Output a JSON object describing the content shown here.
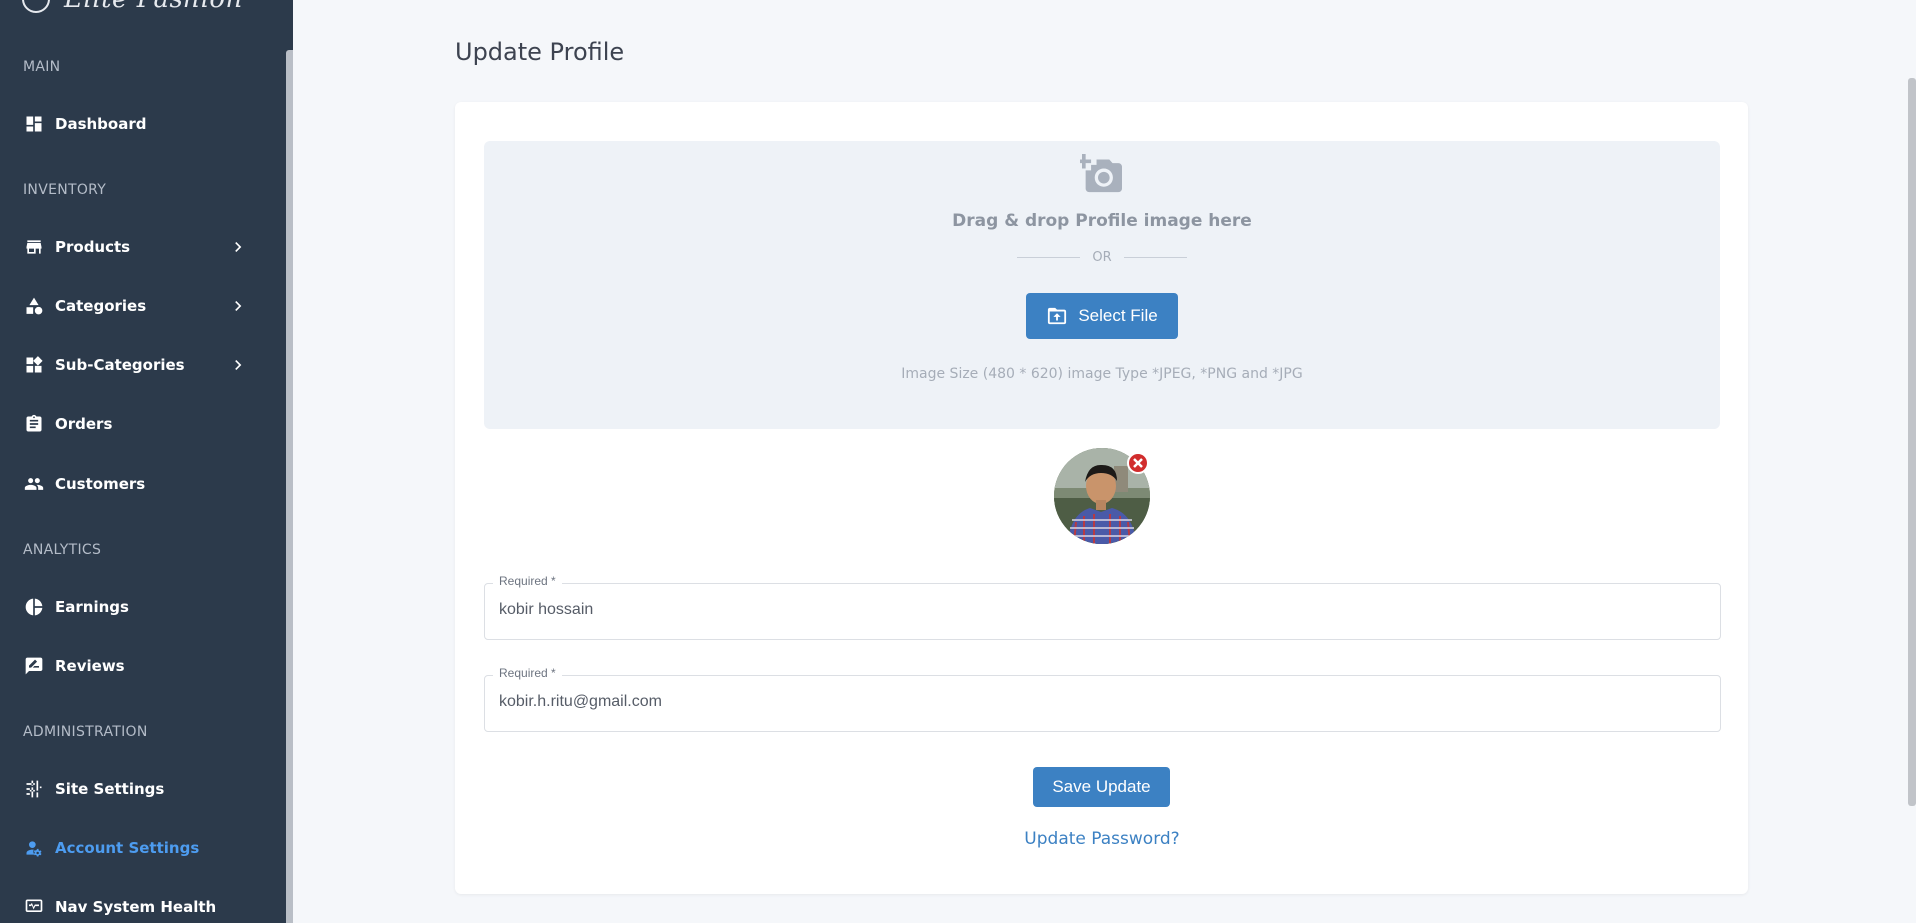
{
  "brand": {
    "name": "Elite Fashion"
  },
  "sidebar": {
    "sections": {
      "main": "MAIN",
      "inventory": "INVENTORY",
      "analytics": "ANALYTICS",
      "administration": "ADMINISTRATION"
    },
    "items": {
      "dashboard": {
        "label": "Dashboard",
        "icon": "dashboard-icon"
      },
      "products": {
        "label": "Products",
        "icon": "store-icon",
        "expandable": true
      },
      "categories": {
        "label": "Categories",
        "icon": "shapes-icon",
        "expandable": true
      },
      "subcategories": {
        "label": "Sub-Categories",
        "icon": "widgets-icon",
        "expandable": true
      },
      "orders": {
        "label": "Orders",
        "icon": "clipboard-icon"
      },
      "customers": {
        "label": "Customers",
        "icon": "people-icon"
      },
      "earnings": {
        "label": "Earnings",
        "icon": "pie-chart-icon"
      },
      "reviews": {
        "label": "Reviews",
        "icon": "rate-review-icon"
      },
      "site_settings": {
        "label": "Site Settings",
        "icon": "sliders-icon"
      },
      "account_settings": {
        "label": "Account Settings",
        "icon": "manage-accounts-icon",
        "active": true
      },
      "nav_system_health": {
        "label": "Nav System Health",
        "icon": "monitor-heart-icon"
      }
    },
    "active_color": "#4d9cf0"
  },
  "main": {
    "title": "Update Profile",
    "upload": {
      "drag_text": "Drag & drop Profile image here",
      "or_text": "OR",
      "select_button": "Select File",
      "size_hint": "Image Size (480 * 620) image Type *JPEG, *PNG and *JPG"
    },
    "fields": {
      "name": {
        "label": "Required *",
        "value": "kobir hossain"
      },
      "email": {
        "label": "Required *",
        "value": "kobir.h.ritu@gmail.com"
      }
    },
    "save_button": "Save Update",
    "update_password_link": "Update Password?"
  },
  "colors": {
    "sidebar_bg": "#2c3a4b",
    "primary": "#3c81c3",
    "danger": "#d12d2d"
  }
}
